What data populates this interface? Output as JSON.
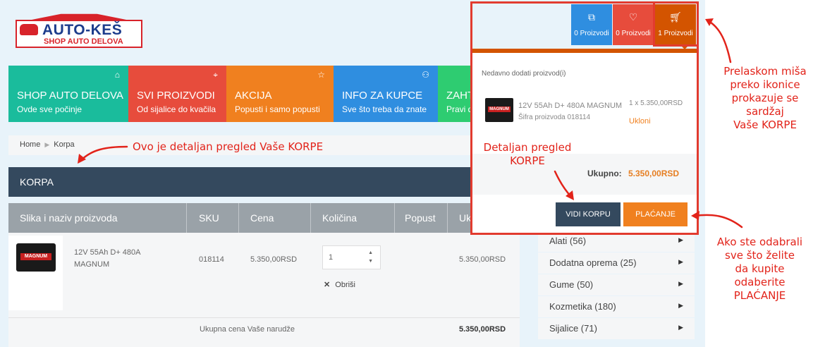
{
  "logo": {
    "name": "AUTO-KEŠ",
    "tagline": "SHOP AUTO DELOVA"
  },
  "header_buttons": [
    {
      "icon": "compare-icon",
      "label": "0 Proizvodi",
      "color": "#2f8ee0"
    },
    {
      "icon": "heart-icon",
      "label": "0 Proizvodi",
      "color": "#e74c3c"
    },
    {
      "icon": "cart-icon",
      "label": "1 Proizvodi",
      "color": "#d35400"
    }
  ],
  "nav": [
    {
      "title": "SHOP AUTO DELOVA",
      "subtitle": "Ovde sve počinje",
      "color": "#1abc9c"
    },
    {
      "title": "SVI PROIZVODI",
      "subtitle": "Od sijalice do kvačila",
      "color": "#e74c3c"
    },
    {
      "title": "AKCIJA",
      "subtitle": "Popusti i samo popusti",
      "color": "#f0801f"
    },
    {
      "title": "INFO ZA KUPCE",
      "subtitle": "Sve što treba da znate",
      "color": "#2f8ee0"
    },
    {
      "title": "ZAHT",
      "subtitle": "Pravi d",
      "color": "#2ecc71"
    }
  ],
  "breadcrumb": {
    "home": "Home",
    "current": "Korpa"
  },
  "cart": {
    "heading": "KORPA",
    "columns": [
      "Slika i naziv proizvoda",
      "SKU",
      "Cena",
      "Količina",
      "Popust",
      "Uk"
    ],
    "item": {
      "name": "12V 55Ah D+ 480A MAGNUM",
      "brand": "MAGNUM",
      "sku": "018114",
      "price": "5.350,00RSD",
      "quantity": "1",
      "total": "5.350,00RSD",
      "remove": "Obriši"
    },
    "order_total_label": "Ukupna cena Vaše narudže",
    "order_total": "5.350,00RSD"
  },
  "categories": [
    {
      "label": "Alati (56)"
    },
    {
      "label": "Dodatna oprema (25)"
    },
    {
      "label": "Gume (50)"
    },
    {
      "label": "Kozmetika (180)"
    },
    {
      "label": "Sijalice (71)"
    }
  ],
  "dropdown": {
    "heading": "Nedavno dodati proizvod(i)",
    "item_name": "12V 55Ah D+ 480A MAGNUM",
    "item_sku": "Šifra proizvoda 018114",
    "item_qty_price": "1 x 5.350,00RSD",
    "remove": "Ukloni",
    "total_label": "Ukupno:",
    "total_value": "5.350,00RSD",
    "view_cart": "VIDI KORPU",
    "checkout": "PLAĆANJE"
  },
  "annotations": {
    "overview": "Ovo je detaljan pregled Vaše KORPE",
    "detail_line1": "Detaljan pregled",
    "detail_line2": "KORPE",
    "hover_line1": "Prelaskom miša",
    "hover_line2": "preko ikonice",
    "hover_line3": "prokazuje se",
    "hover_line4": "sardžaj",
    "hover_line5": "Vaše KORPE",
    "pay_line1": "Ako ste odabrali",
    "pay_line2": "sve što želite",
    "pay_line3": "da kupite",
    "pay_line4": "odaberite",
    "pay_line5": "PLAĆANJE",
    "color": "#e2231a"
  }
}
